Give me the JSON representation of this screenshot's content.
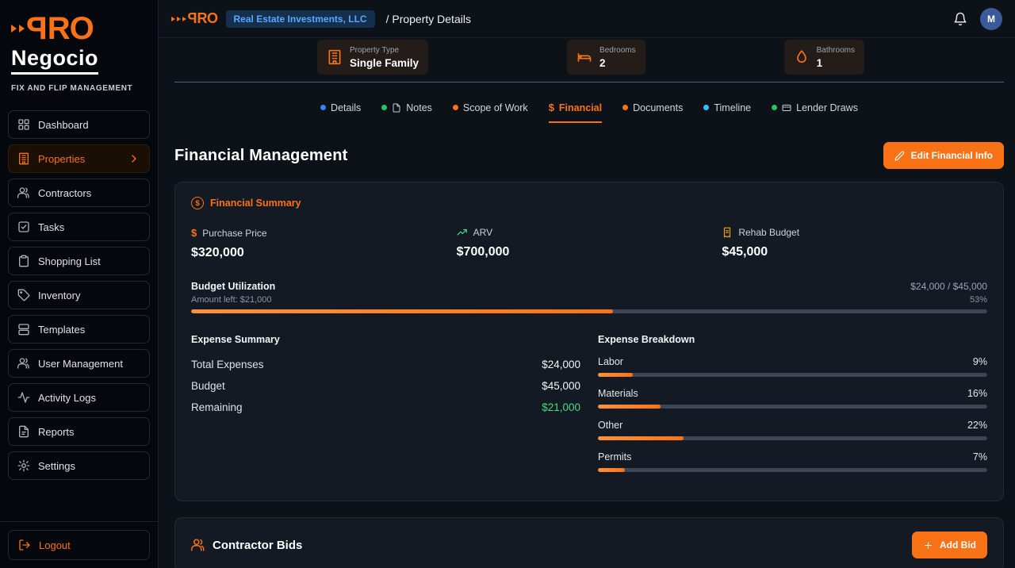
{
  "colors": {
    "accent": "#f97316",
    "positive": "#4ade80",
    "badge_blue": "#59a7ff"
  },
  "brand": {
    "logo_p": "P",
    "logo_ro": "RO",
    "name": "Negocio",
    "tagline": "FIX AND FLIP MANAGEMENT"
  },
  "header": {
    "company": "Real Estate Investments, LLC",
    "breadcrumb": "/ Property Details",
    "avatar": "M"
  },
  "sidebar": {
    "items": [
      {
        "label": "Dashboard",
        "icon": "grid-icon"
      },
      {
        "label": "Properties",
        "icon": "building-icon",
        "active": true
      },
      {
        "label": "Contractors",
        "icon": "people-icon"
      },
      {
        "label": "Tasks",
        "icon": "check-square-icon"
      },
      {
        "label": "Shopping List",
        "icon": "clipboard-icon"
      },
      {
        "label": "Inventory",
        "icon": "tag-icon"
      },
      {
        "label": "Templates",
        "icon": "layout-icon"
      },
      {
        "label": "User Management",
        "icon": "users-icon"
      },
      {
        "label": "Activity Logs",
        "icon": "activity-icon"
      },
      {
        "label": "Reports",
        "icon": "report-icon"
      },
      {
        "label": "Settings",
        "icon": "gear-icon"
      }
    ],
    "logout": "Logout"
  },
  "property_summary": {
    "cards": [
      {
        "label": "Property Type",
        "value": "Single Family",
        "icon": "building-icon"
      },
      {
        "label": "Bedrooms",
        "value": "2",
        "icon": "bed-icon"
      },
      {
        "label": "Bathrooms",
        "value": "1",
        "icon": "bath-icon"
      }
    ]
  },
  "tabs": [
    {
      "label": "Details",
      "icon": "blue-dot"
    },
    {
      "label": "Notes",
      "icon": "green-dot-document"
    },
    {
      "label": "Scope of Work",
      "icon": "orange-dot"
    },
    {
      "label": "Financial",
      "icon": "dollar-icon",
      "active": true
    },
    {
      "label": "Documents",
      "icon": "orange-dot"
    },
    {
      "label": "Timeline",
      "icon": "cyan-dot"
    },
    {
      "label": "Lender Draws",
      "icon": "green-dot-card"
    }
  ],
  "financial": {
    "title": "Financial Management",
    "edit_button": "Edit Financial Info",
    "summary": {
      "card_title": "Financial Summary",
      "metrics": [
        {
          "label": "Purchase Price",
          "value": "$320,000",
          "icon": "dollar-icon"
        },
        {
          "label": "ARV",
          "value": "$700,000",
          "icon": "trend-up-icon"
        },
        {
          "label": "Rehab Budget",
          "value": "$45,000",
          "icon": "receipt-icon"
        }
      ],
      "budget": {
        "title": "Budget Utilization",
        "ratio": "$24,000 / $45,000",
        "amount_left": "Amount left: $21,000",
        "percent_label": "53%",
        "percent": 53
      },
      "expense_summary": {
        "title": "Expense Summary",
        "rows": [
          {
            "label": "Total Expenses",
            "value": "$24,000"
          },
          {
            "label": "Budget",
            "value": "$45,000"
          },
          {
            "label": "Remaining",
            "value": "$21,000",
            "positive": true
          }
        ]
      },
      "expense_breakdown": {
        "title": "Expense Breakdown",
        "rows": [
          {
            "label": "Labor",
            "percent_label": "9%",
            "percent": 9
          },
          {
            "label": "Materials",
            "percent_label": "16%",
            "percent": 16
          },
          {
            "label": "Other",
            "percent_label": "22%",
            "percent": 22
          },
          {
            "label": "Permits",
            "percent_label": "7%",
            "percent": 7
          }
        ]
      }
    }
  },
  "bids": {
    "title": "Contractor Bids",
    "add_button": "Add Bid"
  }
}
